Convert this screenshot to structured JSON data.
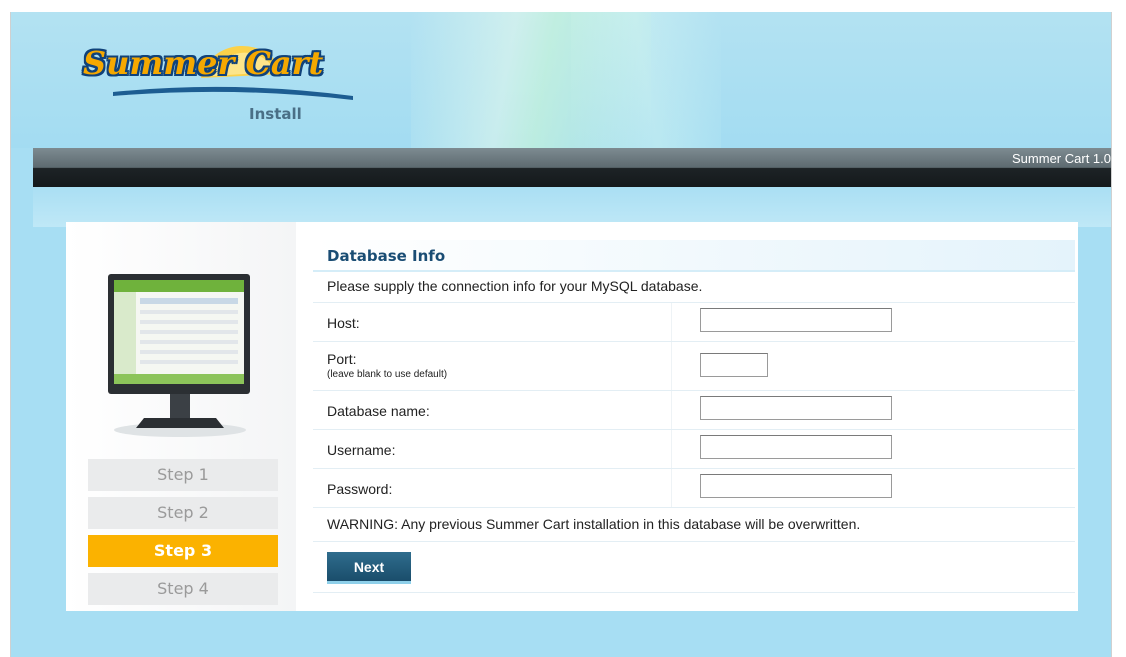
{
  "header": {
    "logo_text": "Summer Cart",
    "logo_sub": "Install",
    "version": "Summer Cart 1.0"
  },
  "steps": [
    {
      "label": "Step 1",
      "active": false
    },
    {
      "label": "Step 2",
      "active": false
    },
    {
      "label": "Step 3",
      "active": true
    },
    {
      "label": "Step 4",
      "active": false
    }
  ],
  "content": {
    "title": "Database Info",
    "description": "Please supply the connection info for your MySQL database.",
    "fields": {
      "host": {
        "label": "Host:",
        "value": ""
      },
      "port": {
        "label": "Port:",
        "hint": "(leave blank to use default)",
        "value": ""
      },
      "database": {
        "label": "Database name:",
        "value": ""
      },
      "username": {
        "label": "Username:",
        "value": ""
      },
      "password": {
        "label": "Password:",
        "value": ""
      }
    },
    "warning": "WARNING: Any previous Summer Cart installation in this database will be overwritten.",
    "next_label": "Next"
  },
  "colors": {
    "accent": "#fbb200",
    "title": "#1a4d74",
    "button": "#1a4d6b",
    "background": "#a7def3"
  }
}
